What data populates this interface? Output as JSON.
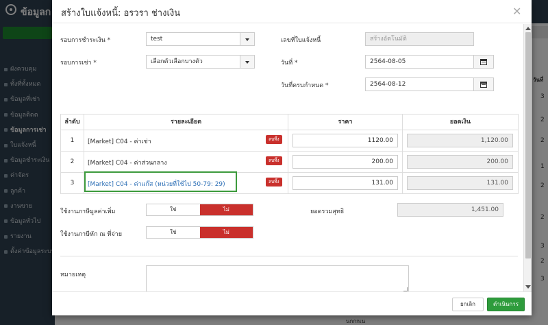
{
  "background": {
    "app_title": "ข้อมูลก",
    "add_button": "สร้างใ",
    "menu": [
      {
        "label": "ผังควบคุม",
        "active": false
      },
      {
        "label": "ทั้งที่ทั้งหมด",
        "active": false
      },
      {
        "label": "ข้อมูลที่เช่า",
        "active": false
      },
      {
        "label": "ข้อมูลติดต",
        "active": false
      },
      {
        "label": "ข้อมูลการเช่า",
        "active": true
      },
      {
        "label": "ใบแจ้งหนี้",
        "active": false
      },
      {
        "label": "ข้อมูลชำระเงิน",
        "active": false
      },
      {
        "label": "ค่าจัดร",
        "active": false
      },
      {
        "label": "ลูกค้า",
        "active": false
      },
      {
        "label": "งานขาย",
        "active": false
      },
      {
        "label": "ข้อมูลทั่วไป",
        "active": false
      },
      {
        "label": "รายงาน",
        "active": false
      },
      {
        "label": "ตั้งค่าข้อมูลระบบ",
        "active": false
      }
    ],
    "right_header": "วันที่",
    "right_numbers": [
      "3",
      "2",
      "2",
      "1",
      "2",
      "2",
      "3",
      "2",
      "3"
    ],
    "bottom_text": "นกกกเน"
  },
  "modal": {
    "title": "สร้างใบแจ้งหนี้: อรวรา ช่างเงิน",
    "form": {
      "payment_round_label": "รอบการชำระเงิน *",
      "payment_round_value": "test",
      "rent_round_label": "รอบการเช่า *",
      "rent_round_value": "เลือกตัวเลือกบางตัว",
      "invoice_no_label": "เลขที่ใบแจ้งหนี้",
      "invoice_no_value": "สร้างอัตโนมัติ",
      "date_label": "วันที่ *",
      "date_value": "2564-08-05",
      "due_date_label": "วันที่ครบกำหนด *",
      "due_date_value": "2564-08-12"
    },
    "table": {
      "headers": [
        "ลำดับ",
        "รายละเอียด",
        "ราคา",
        "ยอดเงิน"
      ],
      "delete_label": "ลบทิ้ง",
      "rows": [
        {
          "index": "1",
          "detail": "[Market] C04 - ค่าเช่า",
          "price": "1120.00",
          "amount": "1,120.00",
          "highlight": false
        },
        {
          "index": "2",
          "detail": "[Market] C04 - ค่าส่วนกลาง",
          "price": "200.00",
          "amount": "200.00",
          "highlight": false
        },
        {
          "index": "3",
          "detail": "[Market] C04 - ค่าแก๊ส (หน่วยที่ใช้ไป 50-79: 29)",
          "price": "131.00",
          "amount": "131.00",
          "highlight": true
        }
      ]
    },
    "vat_label": "ใช้งานภาษีมูลค่าเพิ่ม",
    "wht_label": "ใช้งานภาษีหัก ณ ที่จ่าย",
    "toggle_yes": "ใช่",
    "toggle_no": "ไม่",
    "net_total_label": "ยอดรวมสุทธิ",
    "net_total_value": "1,451.00",
    "note_label": "หมายเหตุ",
    "cancel_label": "ยกเลิก",
    "submit_label": "ดำเนินการ"
  },
  "colors": {
    "accent_green": "#2e9c3c",
    "danger_red": "#c9302c",
    "highlight_border": "#3c9a3c"
  }
}
